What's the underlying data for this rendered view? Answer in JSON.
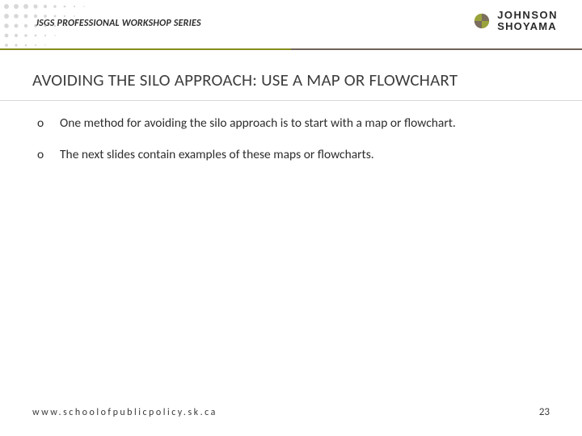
{
  "header": {
    "series_title": "JSGS PROFESSIONAL WORKSHOP SERIES",
    "logo_line1": "JOHNSON",
    "logo_line2": "SHOYAMA"
  },
  "title": "AVOIDING THE SILO APPROACH: USE A MAP OR FLOWCHART",
  "bullets": [
    {
      "marker": "o",
      "text": "One method for avoiding the silo approach is to start with a map or flowchart."
    },
    {
      "marker": "o",
      "text": "The next slides contain examples of these maps or flowcharts."
    }
  ],
  "footer": {
    "url": "www.schoolofpublicpolicy.sk.ca",
    "page_number": "23"
  }
}
